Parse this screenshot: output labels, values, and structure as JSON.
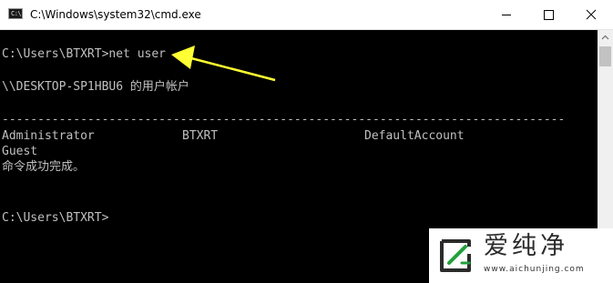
{
  "window": {
    "title": "C:\\Windows\\system32\\cmd.exe",
    "icon": "cmd-icon",
    "icon_text": "C:\\",
    "controls": [
      "minimize-icon",
      "maximize-icon",
      "close-icon"
    ]
  },
  "console": {
    "prompt_command": "C:\\Users\\BTXRT>net user",
    "header": "\\\\DESKTOP-SP1HBU6 的用户帐户",
    "separator": "-------------------------------------------------------------------------------",
    "accounts": [
      "Administrator",
      "BTXRT",
      "DefaultAccount",
      "Guest"
    ],
    "result": "命令成功完成。",
    "prompt": "C:\\Users\\BTXRT>"
  },
  "annotation": {
    "color": "#ffff33",
    "icon": "arrow-pointer-icon"
  },
  "watermark": {
    "name": "爱纯净",
    "url": "www.aichunjing.com",
    "accent_color": "#22a03c"
  }
}
